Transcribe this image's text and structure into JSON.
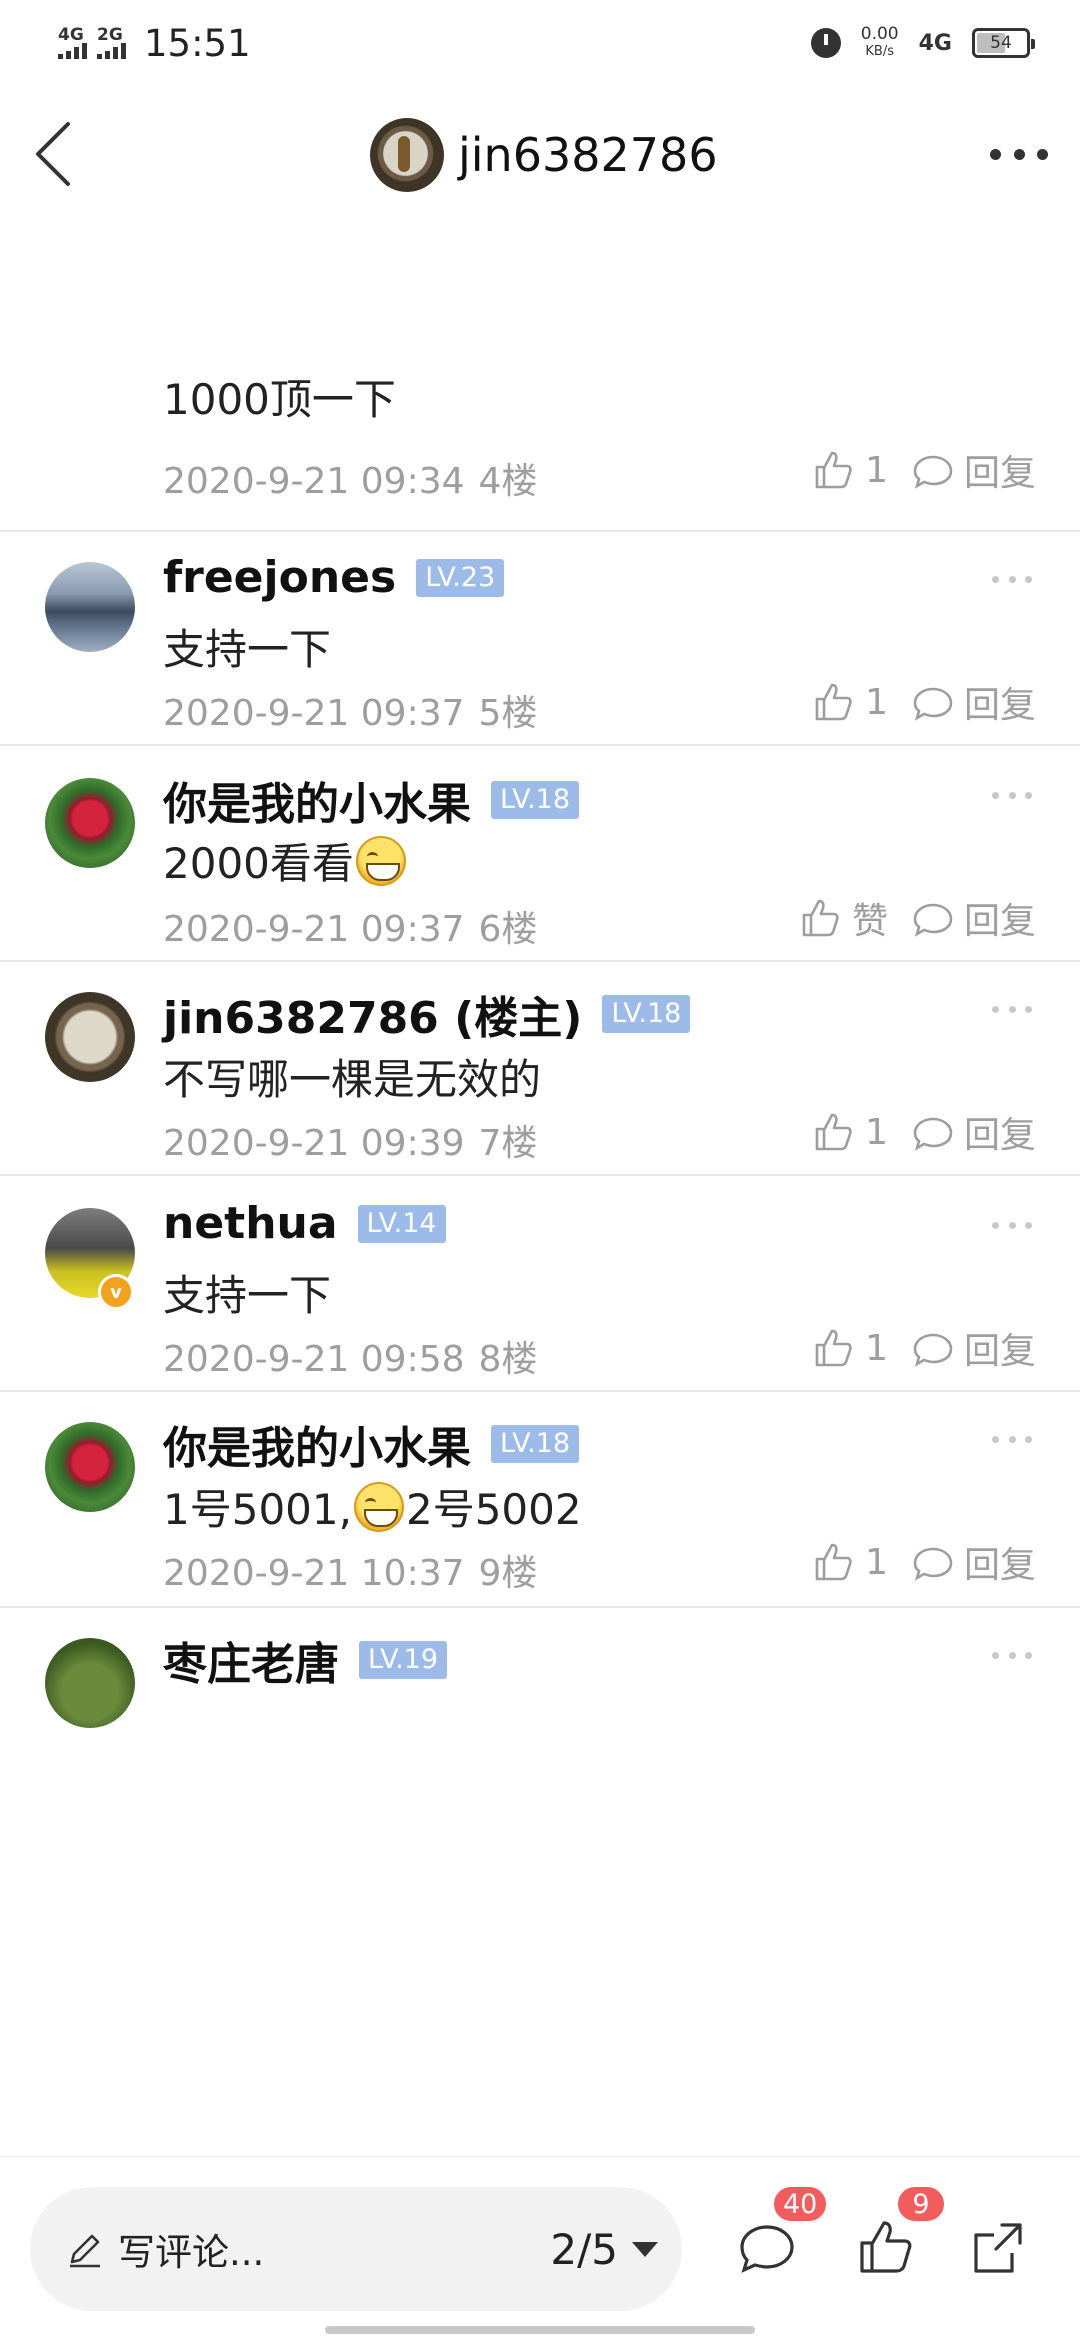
{
  "status_bar": {
    "sig1_label": "4G",
    "sig2_label": "2G",
    "time": "15:51",
    "net_speed": "0.00",
    "net_unit": "KB/s",
    "net_type": "4G",
    "battery": "54"
  },
  "header": {
    "title": "jin6382786"
  },
  "comments": [
    {
      "text": "1000顶一下",
      "date": "2020-9-21 09:34",
      "floor": "4楼",
      "likes": "1",
      "reply_label": "回复"
    },
    {
      "username": "freejones",
      "level": "LV.23",
      "text": "支持一下",
      "date": "2020-9-21 09:37",
      "floor": "5楼",
      "likes": "1",
      "reply_label": "回复"
    },
    {
      "username": "你是我的小水果",
      "level": "LV.18",
      "text": "2000看看",
      "date": "2020-9-21 09:37",
      "floor": "6楼",
      "likes": "赞",
      "reply_label": "回复"
    },
    {
      "username": "jin6382786 (楼主)",
      "level": "LV.18",
      "text": "不写哪一棵是无效的",
      "date": "2020-9-21 09:39",
      "floor": "7楼",
      "likes": "1",
      "reply_label": "回复"
    },
    {
      "username": "nethua",
      "level": "LV.14",
      "text": "支持一下",
      "date": "2020-9-21 09:58",
      "floor": "8楼",
      "likes": "1",
      "reply_label": "回复"
    },
    {
      "username": "你是我的小水果",
      "level": "LV.18",
      "text_a": "1号5001,",
      "text_b": "2号5002",
      "date": "2020-9-21 10:37",
      "floor": "9楼",
      "likes": "1",
      "reply_label": "回复"
    },
    {
      "username": "枣庄老唐",
      "level": "LV.19"
    }
  ],
  "bottom_bar": {
    "comment_placeholder": "写评论...",
    "pager": "2/5",
    "comment_count": "40",
    "like_count": "9"
  },
  "icons": [
    "back-icon",
    "more-icon",
    "like-icon",
    "reply-bubble-icon",
    "pen-icon",
    "comment-icon",
    "share-icon",
    "grin-emoji-icon"
  ],
  "colors": {
    "level_badge": "#9dbbe9",
    "badge_red": "#f25c5c",
    "verified": "#f3a21d",
    "meta_gray": "#9e9e9e"
  }
}
